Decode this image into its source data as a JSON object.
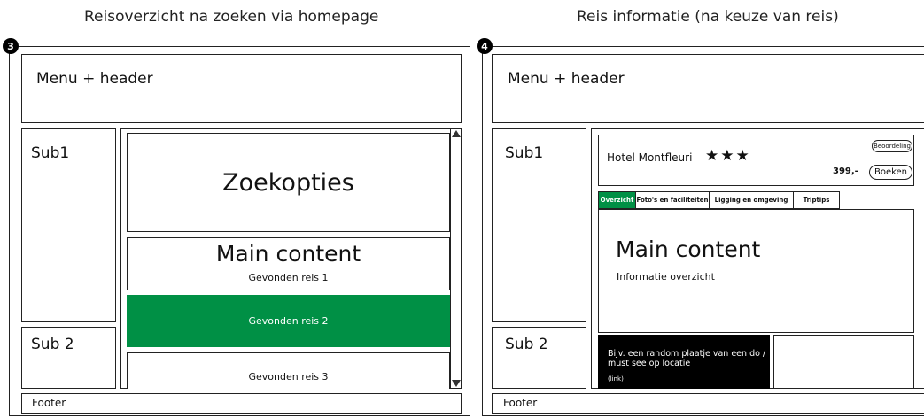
{
  "left": {
    "badge": "3",
    "title": "Reisoverzicht na zoeken via homepage",
    "header": "Menu + header",
    "sub1": "Sub1",
    "sub2": "Sub 2",
    "search": "Zoekopties",
    "main": "Main content",
    "results": [
      "Gevonden reis 1",
      "Gevonden reis 2",
      "Gevonden reis 3"
    ],
    "footer": "Footer"
  },
  "right": {
    "badge": "4",
    "title": "Reis informatie (na keuze van reis)",
    "header": "Menu + header",
    "sub1": "Sub1",
    "sub2": "Sub 2",
    "hotel": "Hotel Montfleuri",
    "stars": "★★★",
    "rating": "Beoordeling",
    "price": "399,-",
    "book": "Boeken",
    "tabs": [
      "Overzicht",
      "Foto's en faciliteiten",
      "Ligging en omgeving",
      "Triptips"
    ],
    "main": "Main content",
    "info": "Informatie overzicht",
    "image_text": "Bijv. een random plaatje van een do / must see op locatie",
    "link": "(link)",
    "footer": "Footer"
  },
  "colors": {
    "accent": "#009045",
    "dark": "#000000"
  }
}
